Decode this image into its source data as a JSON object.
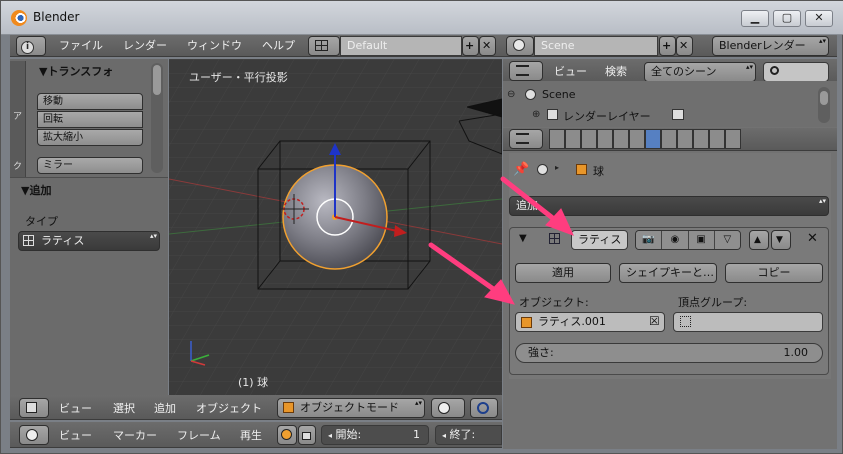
{
  "window": {
    "title": "Blender",
    "controls": [
      "minimize",
      "maximize",
      "close"
    ]
  },
  "top_header": {
    "menus": [
      "ファイル",
      "レンダー",
      "ウィンドウ",
      "ヘルプ"
    ],
    "screen_layout": "Default",
    "scene": "Scene",
    "render_engine": "Blenderレンダー"
  },
  "tool_shelf": {
    "transform_title": "▼トランスフォ",
    "buttons": [
      "移動",
      "回転",
      "拡大縮小",
      "ミラー"
    ],
    "add_title": "▼追加",
    "type_label": "タイプ",
    "type_value": "ラティス"
  },
  "viewport": {
    "view_label": "ユーザー・平行投影",
    "object_label": "(1) 球"
  },
  "view3d_header": {
    "menus": [
      "ビュー",
      "選択",
      "追加",
      "オブジェクト"
    ],
    "mode": "オブジェクトモード"
  },
  "timeline_header": {
    "menus": [
      "ビュー",
      "マーカー",
      "フレーム",
      "再生"
    ],
    "start_label": "開始:",
    "start_value": "1",
    "end_label": "終了:"
  },
  "outliner": {
    "menus": [
      "ビュー",
      "検索"
    ],
    "filter": "全てのシーン",
    "tree": [
      "Scene",
      "レンダーレイヤー"
    ]
  },
  "properties": {
    "breadcrumb_object": "球",
    "add_modifier": "追加",
    "modifier": {
      "name": "ラティス",
      "apply_label": "適用",
      "shapekey_label": "シェイプキーと…",
      "copy_label": "コピー",
      "object_label": "オブジェクト:",
      "object_value": "ラティス.001",
      "vgroup_label": "頂点グループ:",
      "strength_label": "強さ:",
      "strength_value": "1.00"
    }
  },
  "colors": {
    "annotation_arrow": "#ff3d7f",
    "selection_orange": "#f0a030",
    "active_blue": "#5680c2"
  }
}
